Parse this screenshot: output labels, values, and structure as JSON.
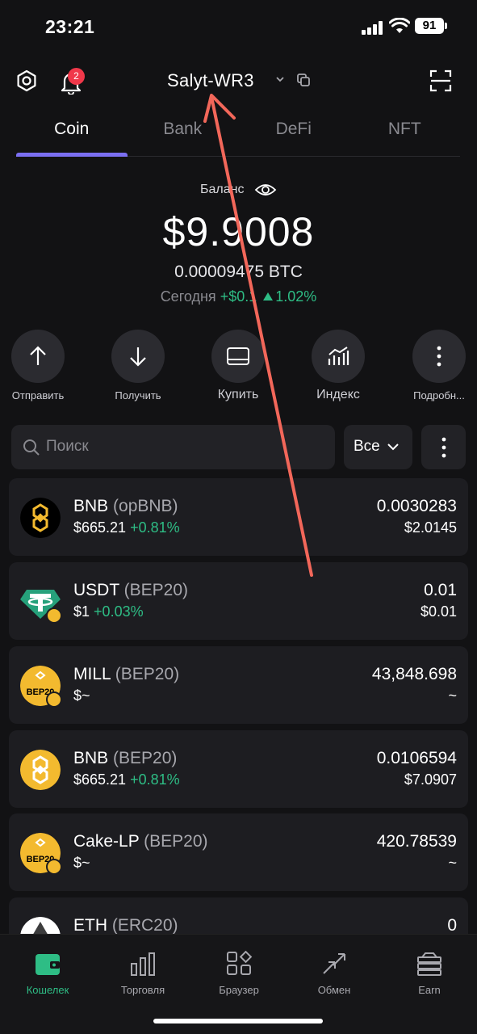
{
  "status_bar": {
    "time": "23:21",
    "battery": "91"
  },
  "header": {
    "wallet_name": "Salyt-WR3",
    "notification_count": "2"
  },
  "tabs": [
    {
      "label": "Coin",
      "active": true
    },
    {
      "label": "Bank",
      "active": false
    },
    {
      "label": "DeFi",
      "active": false
    },
    {
      "label": "NFT",
      "active": false
    }
  ],
  "balance": {
    "label": "Баланс",
    "amount": "$9.9008",
    "btc": "0.00009475 BTC",
    "today_label": "Сегодня",
    "today_change": "+$0.1",
    "today_percent": "1.02%"
  },
  "actions": [
    {
      "label": "Отправить",
      "icon": "arrow-up-icon"
    },
    {
      "label": "Получить",
      "icon": "arrow-down-icon"
    },
    {
      "label": "Купить",
      "icon": "card-icon"
    },
    {
      "label": "Индекс",
      "icon": "chart-icon"
    },
    {
      "label": "Подробн...",
      "icon": "more-vertical-icon"
    }
  ],
  "search": {
    "placeholder": "Поиск",
    "filter_label": "Все"
  },
  "tokens": [
    {
      "name": "BNB",
      "standard": "(opBNB)",
      "price": "$665.21",
      "change": "+0.81%",
      "amount": "0.0030283",
      "value": "$2.0145",
      "icon": "bnb-icon"
    },
    {
      "name": "USDT",
      "standard": "(BEP20)",
      "price": "$1",
      "change": "+0.03%",
      "amount": "0.01",
      "value": "$0.01",
      "icon": "usdt-icon"
    },
    {
      "name": "MILL",
      "standard": "(BEP20)",
      "price": "$~",
      "change": "",
      "amount": "43,848.698",
      "value": "~",
      "icon": "bep20-icon"
    },
    {
      "name": "BNB",
      "standard": "(BEP20)",
      "price": "$665.21",
      "change": "+0.81%",
      "amount": "0.0106594",
      "value": "$7.0907",
      "icon": "bnb-icon"
    },
    {
      "name": "Cake-LP",
      "standard": "(BEP20)",
      "price": "$~",
      "change": "",
      "amount": "420.78539",
      "value": "~",
      "icon": "bep20-icon"
    },
    {
      "name": "ETH",
      "standard": "(ERC20)",
      "price": "",
      "change": "",
      "amount": "0",
      "value": "",
      "icon": "eth-icon"
    }
  ],
  "token_icon_text": "BEP20",
  "bottom_nav": [
    {
      "label": "Кошелек",
      "icon": "wallet-icon",
      "active": true
    },
    {
      "label": "Торговля",
      "icon": "bars-icon",
      "active": false
    },
    {
      "label": "Браузер",
      "icon": "apps-icon",
      "active": false
    },
    {
      "label": "Обмен",
      "icon": "swap-icon",
      "active": false
    },
    {
      "label": "Earn",
      "icon": "earn-icon",
      "active": false
    }
  ],
  "colors": {
    "accent": "#7b6ff2",
    "positive": "#2ebd85",
    "bnb": "#f3ba2f",
    "usdt": "#26a17b",
    "badge": "#f0384a",
    "annotation": "#f2675a"
  }
}
